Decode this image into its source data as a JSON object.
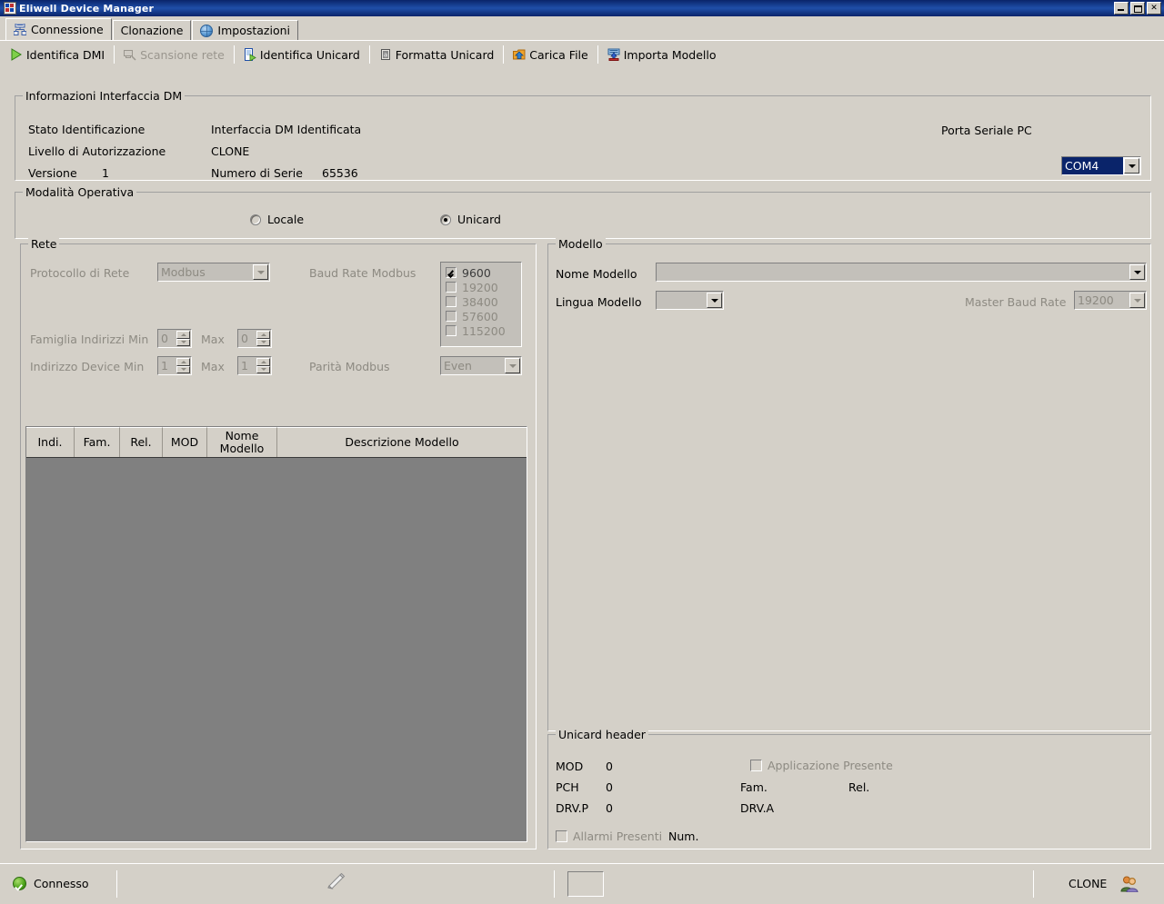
{
  "window": {
    "title": "Eliwell Device Manager",
    "icon": "app-icon",
    "controls": {
      "minimize": "_",
      "maximize": "□",
      "close": "✕"
    }
  },
  "tabs": [
    {
      "label": "Connessione",
      "icon": "network-devices-icon",
      "active": true
    },
    {
      "label": "Clonazione",
      "icon": "",
      "active": false
    },
    {
      "label": "Impostazioni",
      "icon": "globe-icon",
      "active": false
    }
  ],
  "toolbar": [
    {
      "label": "Identifica DMI",
      "icon": "play-green-icon",
      "disabled": false
    },
    {
      "label": "Scansione rete",
      "icon": "scan-network-icon",
      "disabled": true
    },
    {
      "label": "Identifica Unicard",
      "icon": "identify-card-icon",
      "disabled": false
    },
    {
      "label": "Formatta Unicard",
      "icon": "format-card-icon",
      "disabled": false
    },
    {
      "label": "Carica File",
      "icon": "upload-folder-icon",
      "disabled": false
    },
    {
      "label": "Importa Modello",
      "icon": "import-model-icon",
      "disabled": false
    }
  ],
  "interface_info": {
    "group_title": "Informazioni Interfaccia DM",
    "stato_label": "Stato Identificazione",
    "stato_value": "Interfaccia DM Identificata",
    "livello_label": "Livello di Autorizzazione",
    "livello_value": "CLONE",
    "versione_label": "Versione",
    "versione_value": "1",
    "serie_label": "Numero di Serie",
    "serie_value": "65536",
    "porta_label": "Porta Seriale PC",
    "porta_value": "COM4"
  },
  "operating_mode": {
    "group_title": "Modalità Operativa",
    "options": [
      {
        "label": "Locale",
        "selected": false
      },
      {
        "label": "Unicard",
        "selected": true
      }
    ]
  },
  "network": {
    "group_title": "Rete",
    "protocollo_label": "Protocollo di Rete",
    "protocollo_value": "Modbus",
    "famiglia_label": "Famiglia Indirizzi Min",
    "famiglia_min": "0",
    "famiglia_max_label": "Max",
    "famiglia_max": "0",
    "indirizzo_label": "Indirizzo Device Min",
    "indirizzo_min": "1",
    "indirizzo_max_label": "Max",
    "indirizzo_max": "1",
    "baud_label": "Baud Rate Modbus",
    "baud_options": [
      {
        "label": "9600",
        "checked": true
      },
      {
        "label": "19200",
        "checked": false
      },
      {
        "label": "38400",
        "checked": false
      },
      {
        "label": "57600",
        "checked": false
      },
      {
        "label": "115200",
        "checked": false
      }
    ],
    "parita_label": "Parità Modbus",
    "parita_value": "Even"
  },
  "device_table": {
    "columns": [
      {
        "label": "Indi."
      },
      {
        "label": "Fam."
      },
      {
        "label": "Rel."
      },
      {
        "label": "MOD"
      },
      {
        "label": "Nome\nModello"
      },
      {
        "label": "Descrizione Modello"
      }
    ],
    "rows": []
  },
  "model": {
    "group_title": "Modello",
    "nome_label": "Nome Modello",
    "nome_value": "",
    "lingua_label": "Lingua Modello",
    "lingua_value": "",
    "master_baud_label": "Master Baud Rate",
    "master_baud_value": "19200"
  },
  "unicard_header": {
    "group_title": "Unicard header",
    "mod_label": "MOD",
    "mod_value": "0",
    "pch_label": "PCH",
    "pch_value": "0",
    "drvp_label": "DRV.P",
    "drvp_value": "0",
    "applicazione_label": "Applicazione Presente",
    "applicazione_checked": false,
    "fam_label": "Fam.",
    "fam_value": "",
    "rel_label": "Rel.",
    "rel_value": "",
    "drva_label": "DRV.A",
    "drva_value": "",
    "allarmi_label": "Allarmi Presenti",
    "allarmi_checked": false,
    "num_label": "Num.",
    "num_value": ""
  },
  "status_bar": {
    "connection_label": "Connesso",
    "connection_icon": "green-check-icon",
    "progress_icon": "pencil-icon",
    "field_value": "",
    "user_level": "CLONE",
    "user_icon": "users-icon"
  },
  "colors": {
    "window_bg": "#d4d0c8",
    "title_blue": "#0a246a",
    "grid_body": "#808080",
    "disabled_text": "#8d8a82",
    "selection_blue": "#0a246a"
  }
}
